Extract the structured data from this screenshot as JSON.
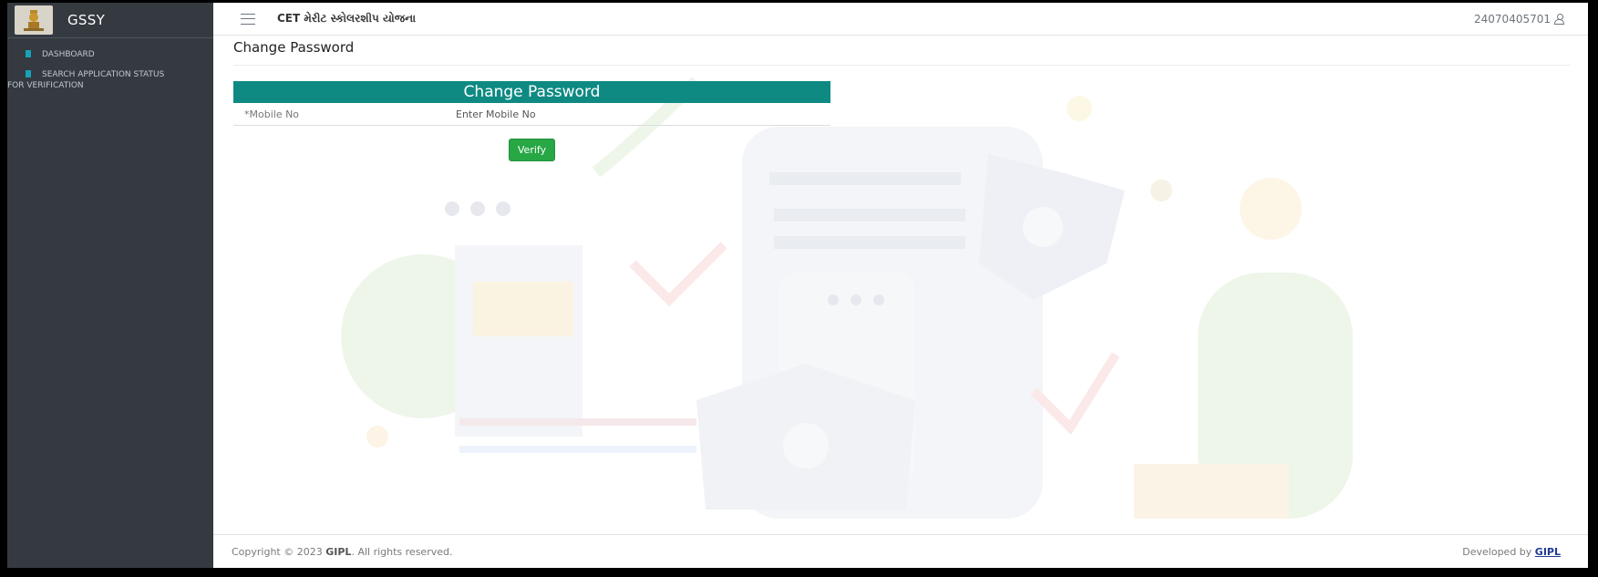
{
  "brand": {
    "name": "GSSY",
    "logo_icon": "state-emblem-icon"
  },
  "sidebar": {
    "items": [
      {
        "label": "DASHBOARD"
      },
      {
        "label": "SEARCH APPLICATION STATUS",
        "label_line2": "FOR VERIFICATION"
      }
    ]
  },
  "header": {
    "app_title": "CET મેરીટ સ્કોલરશીપ યોજના",
    "user_id": "24070405701"
  },
  "main": {
    "page_title": "Change Password",
    "card_title": "Change Password",
    "mobile_label": "*Mobile No",
    "mobile_placeholder": "Enter Mobile No",
    "verify_label": "Verify"
  },
  "footer": {
    "copyright_prefix": "Copyright © 2023",
    "company": "GIPL",
    "copyright_suffix": ". All rights reserved.",
    "developed_by": "Developed by",
    "developer": "GIPL"
  },
  "colors": {
    "sidebar_bg": "#343a40",
    "card_header": "#0e8a83",
    "verify_button": "#28a745"
  }
}
